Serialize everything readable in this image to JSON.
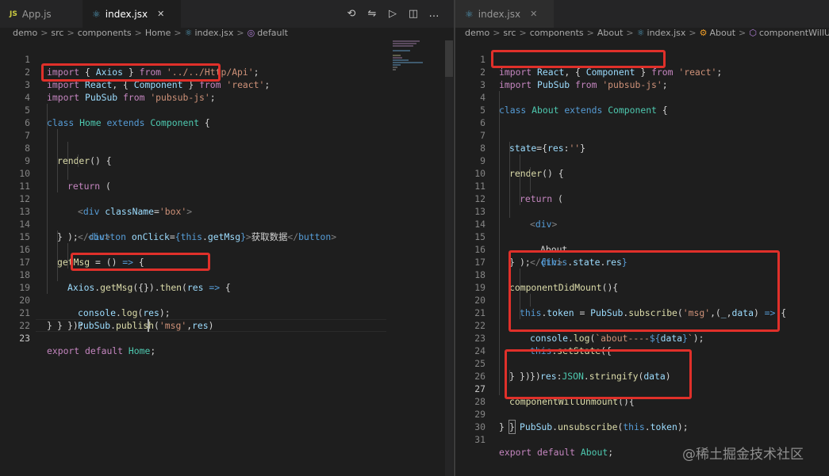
{
  "left": {
    "tabs": [
      {
        "badge": "JS",
        "label": "App.js"
      },
      {
        "label": "index.jsx",
        "close": "✕"
      }
    ],
    "toolbar": {
      "timeline": "⟲",
      "compare": "⇋",
      "run": "▷",
      "split": "◫",
      "more": "…"
    },
    "breadcrumb": {
      "items": [
        "demo",
        "src",
        "components",
        "Home",
        "index.jsx",
        "default"
      ],
      "separator": ">"
    },
    "code": {
      "line_numbers": [
        "1",
        "2",
        "3",
        "4",
        "5",
        "6",
        "7",
        "8",
        "9",
        "10",
        "11",
        "12",
        "13",
        "14",
        "15",
        "16",
        "17",
        "18",
        "19",
        "20",
        "21",
        "22",
        "23"
      ],
      "l1": {
        "kw": "import",
        "pre": " { ",
        "name": "Axios",
        "post": " } ",
        "from": "from",
        "src": "'../../Http/Api'",
        "end": ";"
      },
      "l2": {
        "kw": "import",
        "name": "React",
        "mid": ", { ",
        "name2": "Component",
        "post": " } ",
        "from": "from",
        "src": "'react'",
        "end": ";"
      },
      "l3": {
        "kw": "import",
        "name": "PubSub",
        "from": "from",
        "src": "'pubsub-js'",
        "end": ";"
      },
      "l5": {
        "kw": "class",
        "name": "Home",
        "ext": "extends",
        "base": "Component",
        "end": " {"
      },
      "l7": {
        "fn": "render",
        "end": "() {"
      },
      "l8": {
        "kw": "return",
        "end": " ("
      },
      "l9": {
        "open": "<",
        "tag": "div",
        "attr": "className",
        "eq": "=",
        "val": "'box'",
        "close": ">"
      },
      "l10": {
        "open": "<",
        "tag": "button",
        "attr": "onClick",
        "eq": "=",
        "lb": "{",
        "kw": "this",
        "dot": ".",
        "name": "getMsg",
        "rb": "}",
        "gt": ">",
        "text": "获取数据",
        "end_open": "</",
        "end_tag": "button",
        "end_close": ">"
      },
      "l11": {
        "open": "</",
        "tag": "div",
        "close": ">"
      },
      "l12": {
        "text": ");"
      },
      "l13": {
        "text": "}"
      },
      "l15": {
        "fn": "getMsg",
        "eq": " = ",
        "args": "()",
        "arrow": " => ",
        "end": "{"
      },
      "l16": {
        "obj": "Axios",
        "dot": ".",
        "fn": "getMsg",
        "args": "({})",
        "dot2": ".",
        "fn2": "then",
        "lp": "(",
        "arg": "res",
        "arrow": " => ",
        "end": "{"
      },
      "l17": {
        "obj": "console",
        "dot": ".",
        "fn": "log",
        "lp": "(",
        "arg": "res",
        "end": ");"
      },
      "l18": {
        "obj": "PubSub",
        "dot": ".",
        "fn": "publish",
        "lp": "(",
        "str": "'msg'",
        "comma": ",",
        "arg": "res",
        "end": ")"
      },
      "l19": {
        "text": "});"
      },
      "l20": {
        "text": "}"
      },
      "l21": {
        "text": "}"
      },
      "l23": {
        "kw": "export",
        "kw2": "default",
        "name": "Home",
        "end": ";"
      }
    }
  },
  "right": {
    "tabs": [
      {
        "label": "index.jsx",
        "close": "✕"
      }
    ],
    "breadcrumb": {
      "items": [
        "demo",
        "src",
        "components",
        "About",
        "index.jsx",
        "About",
        "componentWillUnmount"
      ],
      "separator": ">"
    },
    "code": {
      "line_numbers": [
        "1",
        "2",
        "3",
        "4",
        "5",
        "6",
        "7",
        "8",
        "9",
        "10",
        "11",
        "12",
        "13",
        "14",
        "15",
        "16",
        "17",
        "18",
        "19",
        "20",
        "21",
        "22",
        "23",
        "24",
        "25",
        "26",
        "27",
        "28",
        "29",
        "30",
        "31"
      ],
      "l1": {
        "kw": "import",
        "name": "React",
        "mid": ", { ",
        "name2": "Component",
        "post": " } ",
        "from": "from",
        "src": "'react'",
        "end": ";"
      },
      "l2": {
        "kw": "import",
        "name": "PubSub",
        "from": "from",
        "src": "'pubsub-js'",
        "end": ";"
      },
      "l4": {
        "kw": "class",
        "name": "About",
        "ext": "extends",
        "base": "Component",
        "end": " {"
      },
      "l6": {
        "name": "state",
        "eq": "={",
        "key": "res",
        "colon": ":",
        "str": "''",
        "end": "}"
      },
      "l8": {
        "fn": "render",
        "end": "() {"
      },
      "l9": {
        "kw": "return",
        "end": " ("
      },
      "l10": {
        "open": "<",
        "tag": "div",
        "close": ">"
      },
      "l11": {
        "text": "About"
      },
      "l12": {
        "lb": "{",
        "kw": "this",
        "dot": ".",
        "name": "state",
        "dot2": ".",
        "name2": "res",
        "rb": "}"
      },
      "l13": {
        "open": "</",
        "tag": "div",
        "close": ">"
      },
      "l14": {
        "text": ");"
      },
      "l15": {
        "text": "}"
      },
      "l17": {
        "fn": "componentDidMount",
        "end": "(){"
      },
      "l18": {
        "kw": "this",
        "dot": ".",
        "name": "token",
        "eq": " = ",
        "obj": "PubSub",
        "dot2": ".",
        "fn": "subscribe",
        "lp": "(",
        "str": "'msg'",
        "comma": ",(",
        "a1": "_",
        "comma2": ",",
        "a2": "data",
        "rp": ")",
        "arrow": " => ",
        "end": "{"
      },
      "l19": {
        "obj": "console",
        "dot": ".",
        "fn": "log",
        "lp": "(",
        "tmpl1": "`about----",
        "interp_open": "${",
        "var": "data",
        "interp_close": "}",
        "tmpl2": "`",
        "end": ");"
      },
      "l20": {
        "kw": "this",
        "dot": ".",
        "fn": "setState",
        "end": "({"
      },
      "l21": {
        "key": "res",
        "colon": ":",
        "obj": "JSON",
        "dot": ".",
        "fn": "stringify",
        "lp": "(",
        "arg": "data",
        "end": ")"
      },
      "l22": {
        "text": "})"
      },
      "l23": {
        "text": "})"
      },
      "l24": {
        "text": "}"
      },
      "l26": {
        "fn": "componentWillUnmount",
        "end": "(){"
      },
      "l27": {
        "obj": "PubSub",
        "dot": ".",
        "fn": "unsubscribe",
        "lp": "(",
        "kw": "this",
        "dot2": ".",
        "name": "token",
        "end": ");"
      },
      "l28": {
        "text": "}"
      },
      "l29": {
        "text": "}"
      },
      "l31": {
        "kw": "export",
        "kw2": "default",
        "name": "About",
        "end": ";"
      }
    }
  },
  "watermark": "@稀土掘金技术社区",
  "colors": {
    "highlight_box": "#e0302a",
    "keyword": "#569cd6",
    "control": "#c586c0",
    "string": "#ce9178",
    "function": "#dcdcaa",
    "type": "#4ec9b0",
    "variable": "#9cdcfe"
  }
}
